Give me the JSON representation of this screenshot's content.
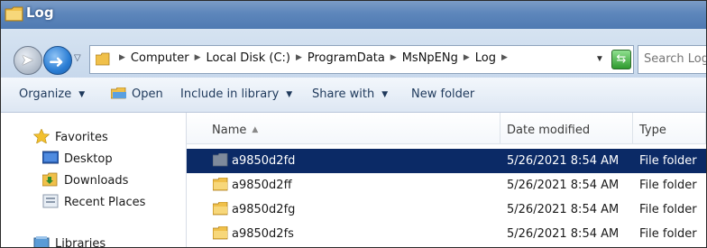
{
  "window": {
    "title": "Log"
  },
  "address": {
    "crumbs": [
      "Computer",
      "Local Disk (C:)",
      "ProgramData",
      "MsNpENg",
      "Log"
    ]
  },
  "search": {
    "placeholder": "Search Log"
  },
  "toolbar": {
    "organize": "Organize",
    "open": "Open",
    "include_in_library": "Include in library",
    "share_with": "Share with",
    "new_folder": "New folder"
  },
  "nav": {
    "favorites": "Favorites",
    "items": [
      "Desktop",
      "Downloads",
      "Recent Places"
    ],
    "libraries": "Libraries"
  },
  "columns": {
    "name": "Name",
    "date_modified": "Date modified",
    "type": "Type"
  },
  "rows": [
    {
      "name": "a9850d2fd",
      "date": "5/26/2021 8:54 AM",
      "type": "File folder"
    },
    {
      "name": "a9850d2ff",
      "date": "5/26/2021 8:54 AM",
      "type": "File folder"
    },
    {
      "name": "a9850d2fg",
      "date": "5/26/2021 8:54 AM",
      "type": "File folder"
    },
    {
      "name": "a9850d2fs",
      "date": "5/26/2021 8:54 AM",
      "type": "File folder"
    }
  ],
  "selected_row": 0,
  "colors": {
    "selection": "#0b2a66",
    "folder": "#e8b84a",
    "titlebar": "#5d86bb"
  }
}
